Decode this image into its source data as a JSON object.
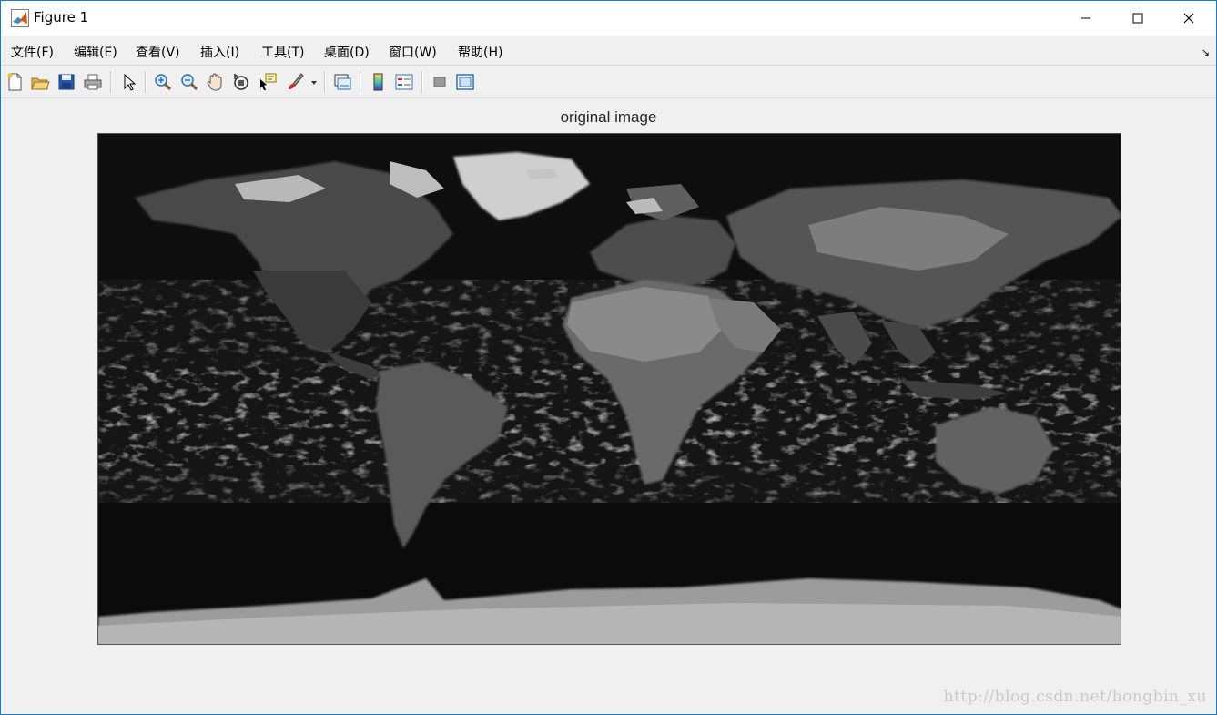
{
  "window": {
    "title": "Figure 1"
  },
  "menu": [
    "文件(F)",
    "编辑(E)",
    "查看(V)",
    "插入(I)",
    "工具(T)",
    "桌面(D)",
    "窗口(W)",
    "帮助(H)"
  ],
  "toolbar": [
    "new-figure-icon",
    "open-file-icon",
    "save-icon",
    "print-icon",
    "edit-plot-icon",
    "zoom-in-icon",
    "zoom-out-icon",
    "pan-icon",
    "rotate-3d-icon",
    "data-cursor-icon",
    "brush-icon",
    "link-plot-icon",
    "colorbar-icon",
    "legend-icon",
    "hide-plot-tools-icon",
    "show-plot-tools-icon"
  ],
  "figure": {
    "title": "original image"
  },
  "watermark": "http://blog.csdn.net/hongbin_xu"
}
